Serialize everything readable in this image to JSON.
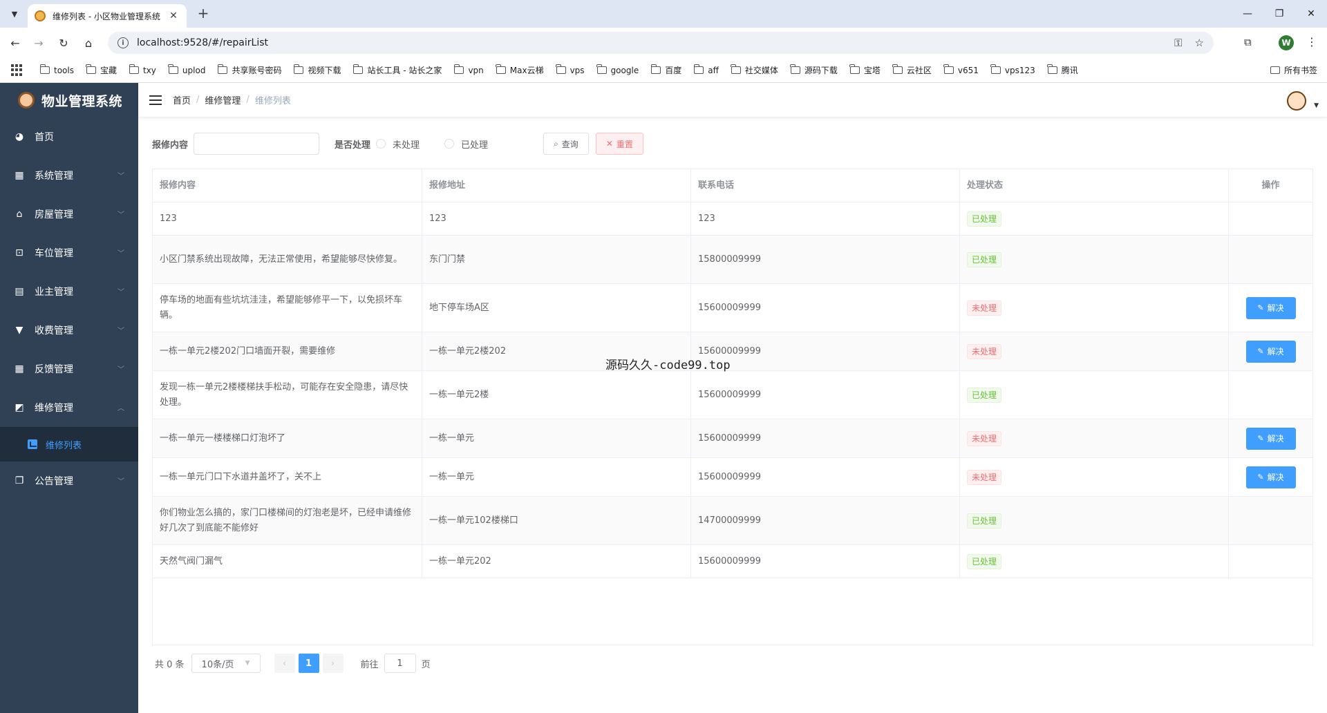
{
  "browser": {
    "tab_title": "维修列表 - 小区物业管理系统",
    "url": "localhost:9528/#/repairList",
    "profile_initial": "W",
    "bookmarks": [
      "tools",
      "宝藏",
      "txy",
      "uplod",
      "共享账号密码",
      "视频下载",
      "站长工具 - 站长之家",
      "vpn",
      "Max云梯",
      "vps",
      "google",
      "百度",
      "aff",
      "社交媒体",
      "源码下载",
      "宝塔",
      "云社区",
      "v651",
      "vps123",
      "腾讯"
    ],
    "bookmarks_right": "所有书签"
  },
  "sidebar": {
    "title": "物业管理系统",
    "items": [
      {
        "label": "首页",
        "icon": "dashboard-icon"
      },
      {
        "label": "系统管理",
        "icon": "grid-icon"
      },
      {
        "label": "房屋管理",
        "icon": "home-icon"
      },
      {
        "label": "车位管理",
        "icon": "car-icon"
      },
      {
        "label": "业主管理",
        "icon": "table-icon"
      },
      {
        "label": "收费管理",
        "icon": "money-icon"
      },
      {
        "label": "反馈管理",
        "icon": "calendar-icon"
      },
      {
        "label": "维修管理",
        "icon": "chart-icon"
      },
      {
        "label": "公告管理",
        "icon": "notice-icon"
      }
    ],
    "active_sub": "维修列表"
  },
  "breadcrumb": [
    "首页",
    "维修管理",
    "维修列表"
  ],
  "filter": {
    "content_label": "报修内容",
    "content_value": "",
    "status_label": "是否处理",
    "opt_unhandled": "未处理",
    "opt_handled": "已处理",
    "query_label": "查询",
    "reset_label": "重置"
  },
  "table": {
    "headers": [
      "报修内容",
      "报修地址",
      "联系电话",
      "处理状态",
      "操作"
    ],
    "solve_label": "解决",
    "rows": [
      {
        "content": "123",
        "address": "123",
        "phone": "123",
        "status": "已处理",
        "done": true
      },
      {
        "content": "小区门禁系统出现故障，无法正常使用，希望能够尽快修复。",
        "address": "东门门禁",
        "phone": "15800009999",
        "status": "已处理",
        "done": true
      },
      {
        "content": "停车场的地面有些坑坑洼洼，希望能够修平一下，以免损坏车辆。",
        "address": "地下停车场A区",
        "phone": "15600009999",
        "status": "未处理",
        "done": false
      },
      {
        "content": "一栋一单元2楼202门口墙面开裂，需要维修",
        "address": "一栋一单元2楼202",
        "phone": "15600009999",
        "status": "未处理",
        "done": false
      },
      {
        "content": "发现一栋一单元2楼楼梯扶手松动，可能存在安全隐患，请尽快处理。",
        "address": "一栋一单元2楼",
        "phone": "15600009999",
        "status": "已处理",
        "done": true
      },
      {
        "content": "一栋一单元一楼楼梯口灯泡坏了",
        "address": "一栋一单元",
        "phone": "15600009999",
        "status": "未处理",
        "done": false
      },
      {
        "content": "一栋一单元门口下水道井盖坏了，关不上",
        "address": "一栋一单元",
        "phone": "15600009999",
        "status": "未处理",
        "done": false
      },
      {
        "content": "你们物业怎么搞的，家门口楼梯间的灯泡老是坏，已经申请维修好几次了到底能不能修好",
        "address": "一栋一单元102楼梯口",
        "phone": "14700009999",
        "status": "已处理",
        "done": true
      },
      {
        "content": "天然气阀门漏气",
        "address": "一栋一单元202",
        "phone": "15600009999",
        "status": "已处理",
        "done": true
      }
    ]
  },
  "pagination": {
    "total": "共 0 条",
    "page_size": "10条/页",
    "current_page": "1",
    "goto_prefix": "前往",
    "goto_value": "1",
    "goto_suffix": "页"
  },
  "overlay_text": "源码久久-code99.top"
}
